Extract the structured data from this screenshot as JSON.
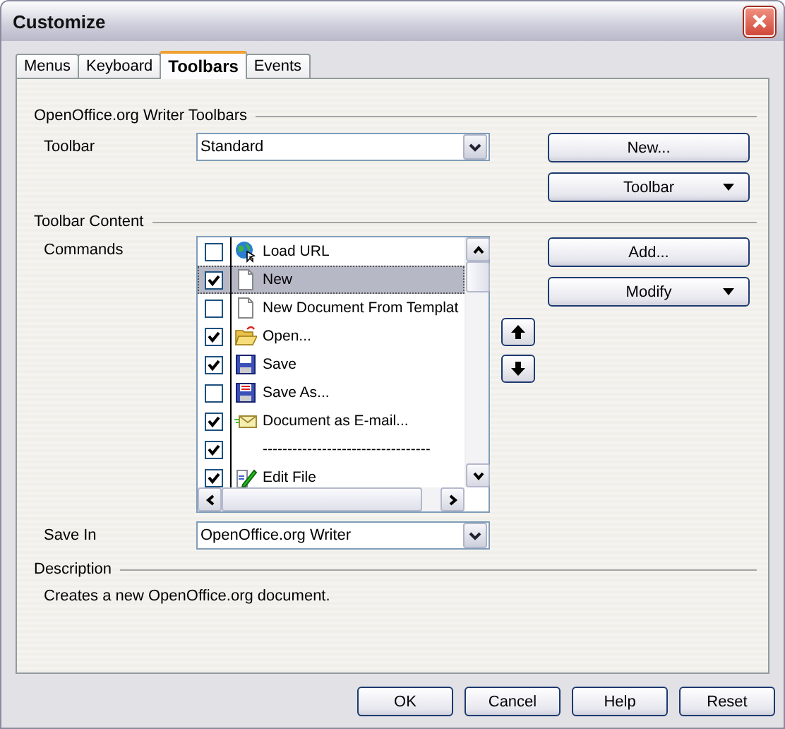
{
  "window": {
    "title": "Customize"
  },
  "tabs": [
    {
      "label": "Menus",
      "selected": false
    },
    {
      "label": "Keyboard",
      "selected": false
    },
    {
      "label": "Toolbars",
      "selected": true
    },
    {
      "label": "Events",
      "selected": false
    }
  ],
  "toolbars_section": {
    "heading": "OpenOffice.org Writer Toolbars",
    "toolbar_label": "Toolbar",
    "toolbar_value": "Standard",
    "new_button": "New...",
    "toolbar_button": "Toolbar"
  },
  "content_section": {
    "heading": "Toolbar Content",
    "commands_label": "Commands",
    "commands": [
      {
        "kind": "globe",
        "label": "Load URL",
        "checked": false,
        "selected": false
      },
      {
        "kind": "document",
        "label": "New",
        "checked": true,
        "selected": true
      },
      {
        "kind": "document",
        "label": "New Document From Templat",
        "checked": false,
        "selected": false
      },
      {
        "kind": "folder",
        "label": "Open...",
        "checked": true,
        "selected": false
      },
      {
        "kind": "floppy",
        "label": "Save",
        "checked": true,
        "selected": false
      },
      {
        "kind": "floppy-red",
        "label": "Save As...",
        "checked": false,
        "selected": false
      },
      {
        "kind": "mail",
        "label": "Document as E-mail...",
        "checked": true,
        "selected": false
      },
      {
        "kind": "separator",
        "label": "----------------------------------",
        "checked": true,
        "selected": false
      },
      {
        "kind": "edit",
        "label": "Edit File",
        "checked": true,
        "selected": false
      }
    ],
    "add_button": "Add...",
    "modify_button": "Modify",
    "save_in_label": "Save In",
    "save_in_value": "OpenOffice.org Writer"
  },
  "description": {
    "heading": "Description",
    "text": "Creates a new OpenOffice.org document."
  },
  "buttons": [
    "OK",
    "Cancel",
    "Help",
    "Reset"
  ]
}
